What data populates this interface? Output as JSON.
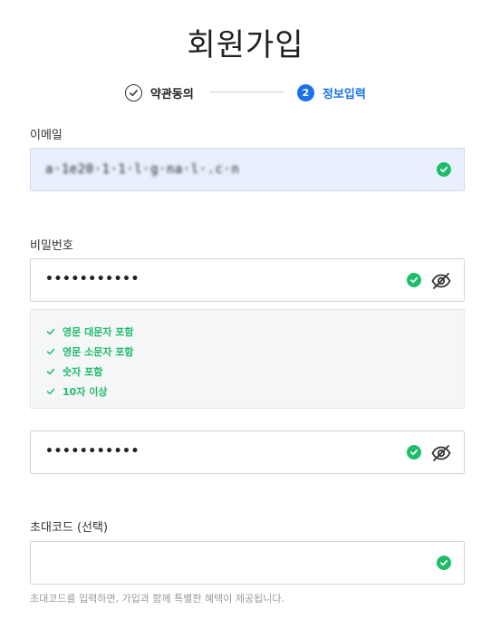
{
  "page": {
    "title": "회원가입"
  },
  "stepper": {
    "steps": [
      {
        "label": "약관동의",
        "status": "done",
        "icon": "check-icon"
      },
      {
        "label": "정보입력",
        "status": "current",
        "number": "2"
      }
    ],
    "active_color": "#1a73e8"
  },
  "email": {
    "label": "이메일",
    "value": "a·1e20·1·1·l·g·na·l·.c·n",
    "status": "valid"
  },
  "password": {
    "label": "비밀번호",
    "value": "•••••••••••",
    "status": "valid",
    "visibility_toggle": "eye-slash-icon"
  },
  "password_rules": [
    {
      "text": "영문 대문자 포함",
      "met": true
    },
    {
      "text": "영문 소문자 포함",
      "met": true
    },
    {
      "text": "숫자 포함",
      "met": true
    },
    {
      "text": "10자 이상",
      "met": true
    }
  ],
  "password_confirm": {
    "value": "•••••••••••",
    "status": "valid",
    "visibility_toggle": "eye-slash-icon"
  },
  "invite_code": {
    "label": "초대코드 (선택)",
    "value": "",
    "status": "valid",
    "hint": "초대코드를 입력하면, 가입과 함께 특별한 혜택이 제공됩니다."
  },
  "colors": {
    "success": "#1fbd6b",
    "primary": "#1a73e8",
    "filled_bg": "#e9f0fd"
  }
}
